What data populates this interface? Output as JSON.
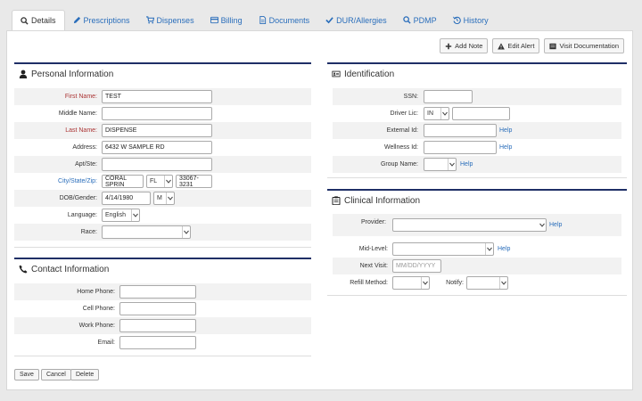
{
  "tabs": [
    {
      "label": "Details",
      "icon": "search-icon",
      "active": true
    },
    {
      "label": "Prescriptions",
      "icon": "pencil-icon"
    },
    {
      "label": "Dispenses",
      "icon": "cart-icon"
    },
    {
      "label": "Billing",
      "icon": "credit-card-icon"
    },
    {
      "label": "Documents",
      "icon": "document-icon"
    },
    {
      "label": "DUR/Allergies",
      "icon": "check-icon"
    },
    {
      "label": "PDMP",
      "icon": "search-icon"
    },
    {
      "label": "History",
      "icon": "history-icon"
    }
  ],
  "toolbar": {
    "add_note": "Add Note",
    "edit_alert": "Edit Alert",
    "visit_documentation": "Visit Documentation"
  },
  "personal": {
    "title": "Personal Information",
    "first_name_label": "First Name:",
    "first_name": "TEST",
    "middle_name_label": "Middle Name:",
    "middle_name": "",
    "last_name_label": "Last Name:",
    "last_name": "DISPENSE",
    "address_label": "Address:",
    "address": "6432 W SAMPLE RD",
    "apt_label": "Apt/Ste:",
    "apt": "",
    "city_state_zip_label": "City/State/Zip:",
    "city": "CORAL SPRIN",
    "state": "FL",
    "zip": "33067-3231",
    "dob_gender_label": "DOB/Gender:",
    "dob": "4/14/1980",
    "gender": "M",
    "language_label": "Language:",
    "language": "English",
    "race_label": "Race:",
    "race": ""
  },
  "contact": {
    "title": "Contact Information",
    "home_phone_label": "Home Phone:",
    "cell_phone_label": "Cell Phone:",
    "work_phone_label": "Work Phone:",
    "email_label": "Email:"
  },
  "identification": {
    "title": "Identification",
    "ssn_label": "SSN:",
    "driver_lic_label": "Driver Lic:",
    "driver_lic_state": "IN",
    "external_id_label": "External Id:",
    "wellness_id_label": "Wellness Id:",
    "group_name_label": "Group Name:",
    "help": "Help"
  },
  "clinical": {
    "title": "Clinical Information",
    "provider_label": "Provider:",
    "mid_level_label": "Mid-Level:",
    "next_visit_label": "Next Visit:",
    "next_visit_placeholder": "MM/DD/YYYY",
    "refill_method_label": "Refill Method:",
    "notify_label": "Notify:",
    "help": "Help"
  },
  "actions": {
    "save": "Save",
    "cancel": "Cancel",
    "delete": "Delete"
  }
}
